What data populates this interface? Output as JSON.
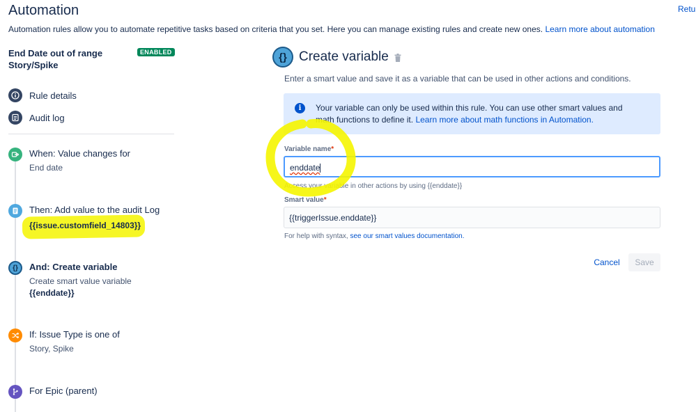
{
  "header": {
    "title": "Automation",
    "return_label": "Retu",
    "description": "Automation rules allow you to automate repetitive tasks based on criteria that you set. Here you can manage existing rules and create new ones.",
    "learn_more_label": "Learn more about automation"
  },
  "rule": {
    "title": "End Date out of range Story/Spike",
    "status_badge": "ENABLED"
  },
  "sidebar": {
    "items": [
      {
        "label": "Rule details",
        "icon": "info-icon"
      },
      {
        "label": "Audit log",
        "icon": "list-icon"
      }
    ]
  },
  "steps": [
    {
      "title": "When: Value changes for",
      "subtitle": "End date",
      "icon": "trigger-icon",
      "color": "#36b37e"
    },
    {
      "title": "Then: Add value to the audit Log",
      "code": "{{issue.customfield_14803}}",
      "icon": "audit-log-icon",
      "color": "#4fa8df"
    },
    {
      "title": "And: Create variable",
      "subtitle": "Create smart value variable",
      "code": "{{enddate}}",
      "icon": "variable-icon",
      "color": "#0065ff"
    },
    {
      "title": "If: Issue Type is one of",
      "subtitle": "Story, Spike",
      "icon": "condition-icon",
      "color": "#ff8b00"
    },
    {
      "title": "For Epic (parent)",
      "icon": "branch-icon",
      "color": "#6554c0"
    }
  ],
  "panel": {
    "title": "Create variable",
    "description": "Enter a smart value and save it as a variable that can be used in other actions and conditions.",
    "info_text": "Your variable can only be used within this rule. You can use other smart values and math functions to define it.",
    "info_link": "Learn more about math functions in Automation.",
    "variable_name_label": "Variable name",
    "variable_name_value": "enddate",
    "variable_help": "Access your variable in other actions by using {{enddate}}",
    "smart_value_label": "Smart value",
    "smart_value_value": "{{triggerIssue.enddate}}",
    "smart_help_prefix": "For help with syntax,",
    "smart_help_link": "see our smart values documentation.",
    "required_marker": "*",
    "cancel_label": "Cancel",
    "save_label": "Save"
  },
  "colors": {
    "accent": "#0052cc",
    "enabled_badge": "#00875a",
    "highlight": "#f5f500"
  }
}
